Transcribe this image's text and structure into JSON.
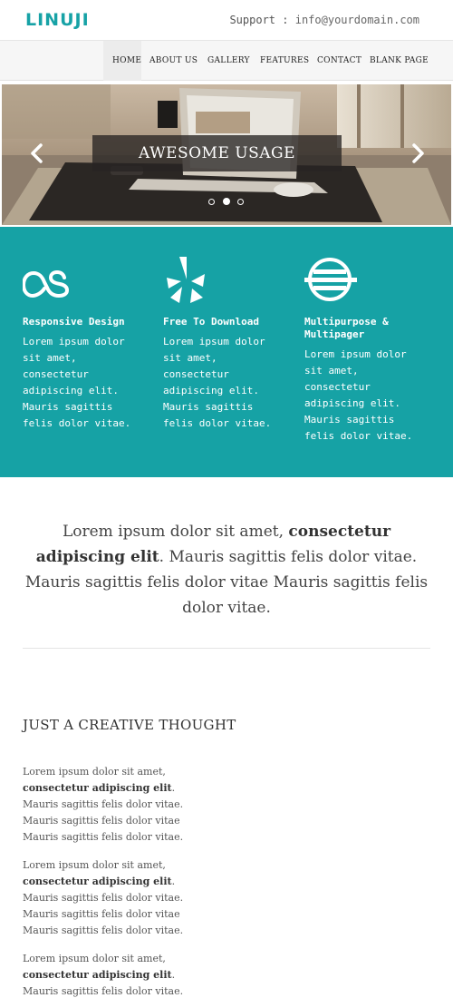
{
  "header": {
    "logo": "LINUJI",
    "support_label": "Support :",
    "support_email": "info@yourdomain.com"
  },
  "nav": {
    "items": [
      {
        "label": "HOME",
        "active": true
      },
      {
        "label": "ABOUT US",
        "active": false
      },
      {
        "label": "GALLERY",
        "active": false
      },
      {
        "label": "FEATURES",
        "active": false
      },
      {
        "label": "CONTACT",
        "active": false
      },
      {
        "label": "BLANK PAGE",
        "active": false
      }
    ]
  },
  "slider": {
    "caption": "AWESOME USAGE",
    "prev_icon": "chevron-left-icon",
    "next_icon": "chevron-right-icon",
    "slides": 3,
    "active_slide": 2
  },
  "features": [
    {
      "icon": "lastfm-icon",
      "title": "Responsive Design",
      "lines": [
        "Lorem ipsum dolor",
        "sit amet,",
        "consectetur",
        "adipiscing elit.",
        "Mauris sagittis",
        "felis dolor vitae."
      ]
    },
    {
      "icon": "yelp-icon",
      "title": "Free To Download",
      "lines": [
        "Lorem ipsum dolor",
        "sit amet,",
        "consectetur",
        "adipiscing elit.",
        "Mauris sagittis",
        "felis dolor vitae."
      ]
    },
    {
      "icon": "globe-icon",
      "title": "Multipurpose & Multipager",
      "lines": [
        "Lorem ipsum dolor",
        "sit amet,",
        "consectetur",
        "adipiscing elit.",
        "Mauris sagittis",
        "felis dolor vitae."
      ]
    }
  ],
  "intro": {
    "lead": "Lorem ipsum dolor sit amet,",
    "bold": "consectetur adipiscing elit",
    "rest": ". Mauris sagittis felis dolor vitae. Mauris sagittis felis dolor vitae Mauris sagittis felis dolor vitae."
  },
  "thought": {
    "heading": "JUST A CREATIVE THOUGHT",
    "paragraphs": [
      {
        "line1": "Lorem ipsum dolor sit amet,",
        "bold": "consectetur adipiscing elit",
        "tail": ".",
        "line3": "Mauris sagittis felis dolor vitae.",
        "line4": "Mauris sagittis felis dolor vitae",
        "line5": "Mauris sagittis felis dolor vitae."
      },
      {
        "line1": "Lorem ipsum dolor sit amet,",
        "bold": "consectetur adipiscing elit",
        "tail": ".",
        "line3": "Mauris sagittis felis dolor vitae.",
        "line4": "Mauris sagittis felis dolor vitae",
        "line5": "Mauris sagittis felis dolor vitae."
      },
      {
        "line1": "Lorem ipsum dolor sit amet,",
        "bold": "consectetur adipiscing elit",
        "tail": ".",
        "line3": "Mauris sagittis felis dolor vitae."
      }
    ]
  },
  "colors": {
    "accent": "#16a2a5",
    "logo": "#17a2a6",
    "caption_bg": "#282422"
  }
}
